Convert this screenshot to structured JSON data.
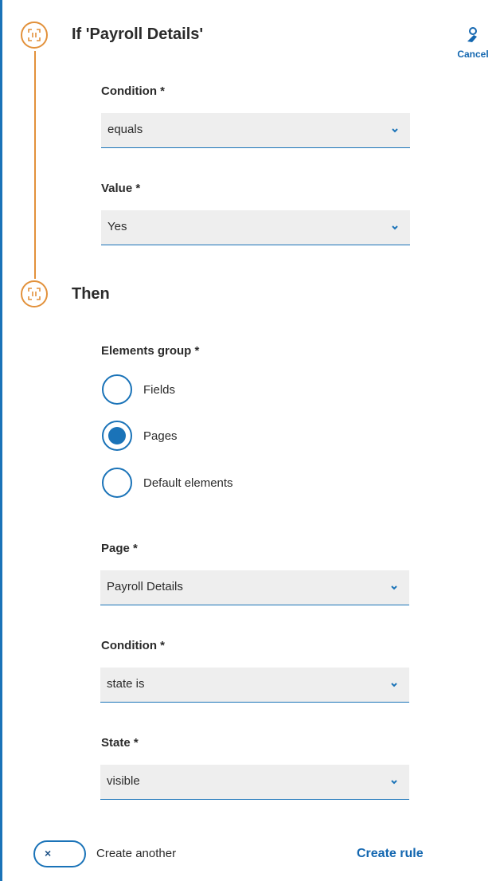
{
  "if_section": {
    "title": "If 'Payroll Details'",
    "condition_label": "Condition *",
    "condition_value": "equals",
    "value_label": "Value *",
    "value_value": "Yes"
  },
  "cancel_label": "Cancel",
  "then_section": {
    "title": "Then",
    "elements_group_label": "Elements group *",
    "options": [
      {
        "label": "Fields",
        "selected": false
      },
      {
        "label": "Pages",
        "selected": true
      },
      {
        "label": "Default elements",
        "selected": false
      }
    ],
    "page_label": "Page *",
    "page_value": "Payroll Details",
    "condition_label": "Condition *",
    "condition_value": "state is",
    "state_label": "State *",
    "state_value": "visible"
  },
  "footer": {
    "toggle_icon": "×",
    "create_another_label": "Create another",
    "create_rule_label": "Create rule"
  },
  "colors": {
    "accent": "#1a73b8",
    "timeline": "#e2913b"
  }
}
